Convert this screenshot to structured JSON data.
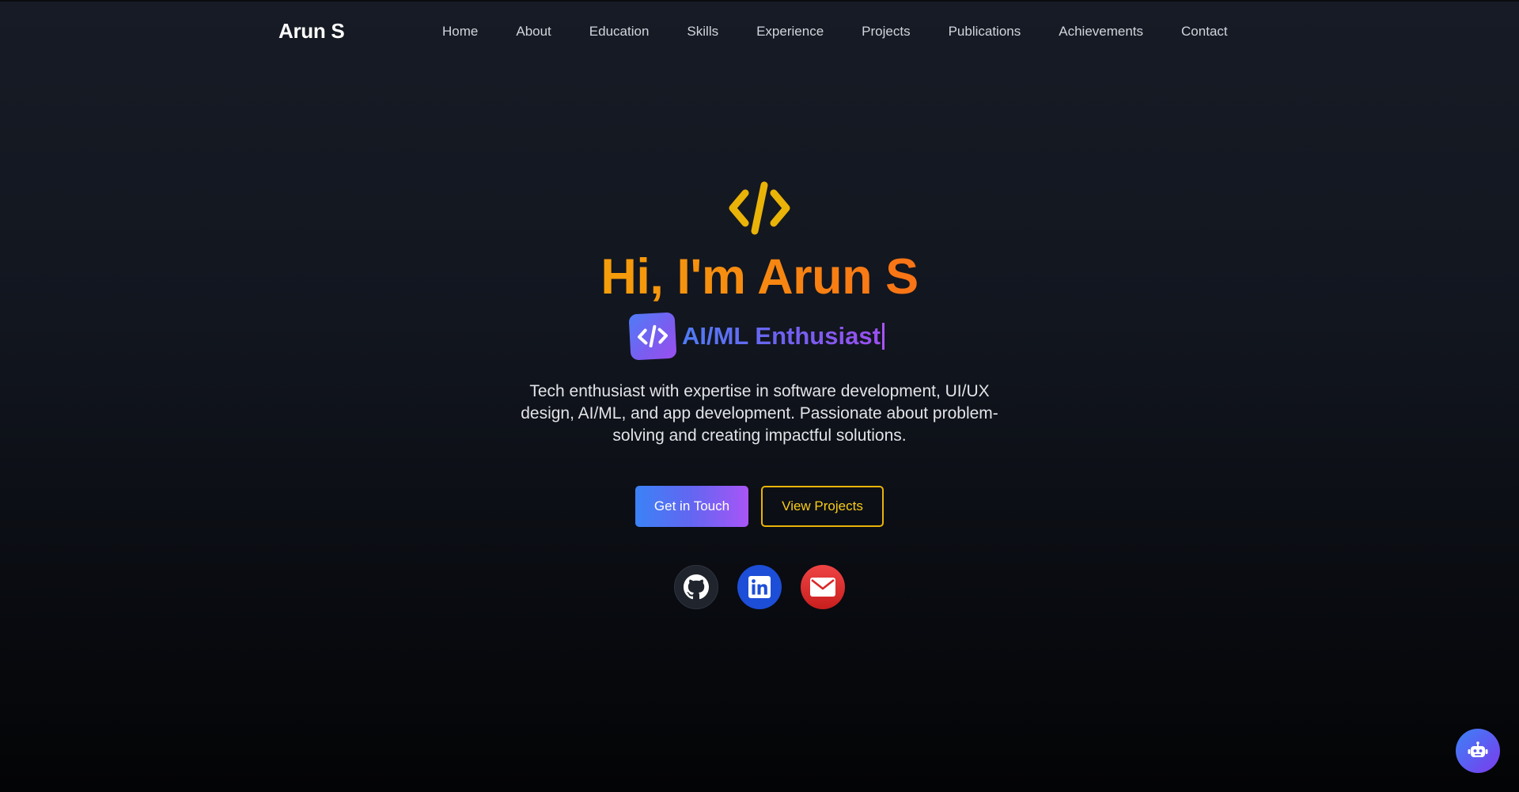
{
  "navbar": {
    "brand": "Arun S",
    "links": [
      "Home",
      "About",
      "Education",
      "Skills",
      "Experience",
      "Projects",
      "Publications",
      "Achievements",
      "Contact"
    ]
  },
  "hero": {
    "icon": "code-icon",
    "greeting": "Hi, I'm Arun S",
    "role_icon": "code-icon",
    "role": "AI/ML Enthusiast",
    "description": "Tech enthusiast with expertise in software development, UI/UX design, AI/ML, and app development. Passionate about problem-solving and creating impactful solutions.",
    "primary_button": "Get in Touch",
    "secondary_button": "View Projects",
    "socials": [
      {
        "icon": "github-icon",
        "color": "#1f242d"
      },
      {
        "icon": "linkedin-icon",
        "color": "#1d4ed8"
      },
      {
        "icon": "email-icon",
        "color": "#dc2626"
      }
    ]
  },
  "chat": {
    "icon": "robot-icon"
  },
  "colors": {
    "accent_orange": "#f59e0b",
    "accent_blue": "#3b82f6",
    "accent_purple": "#a855f7",
    "accent_yellow": "#eab308"
  }
}
